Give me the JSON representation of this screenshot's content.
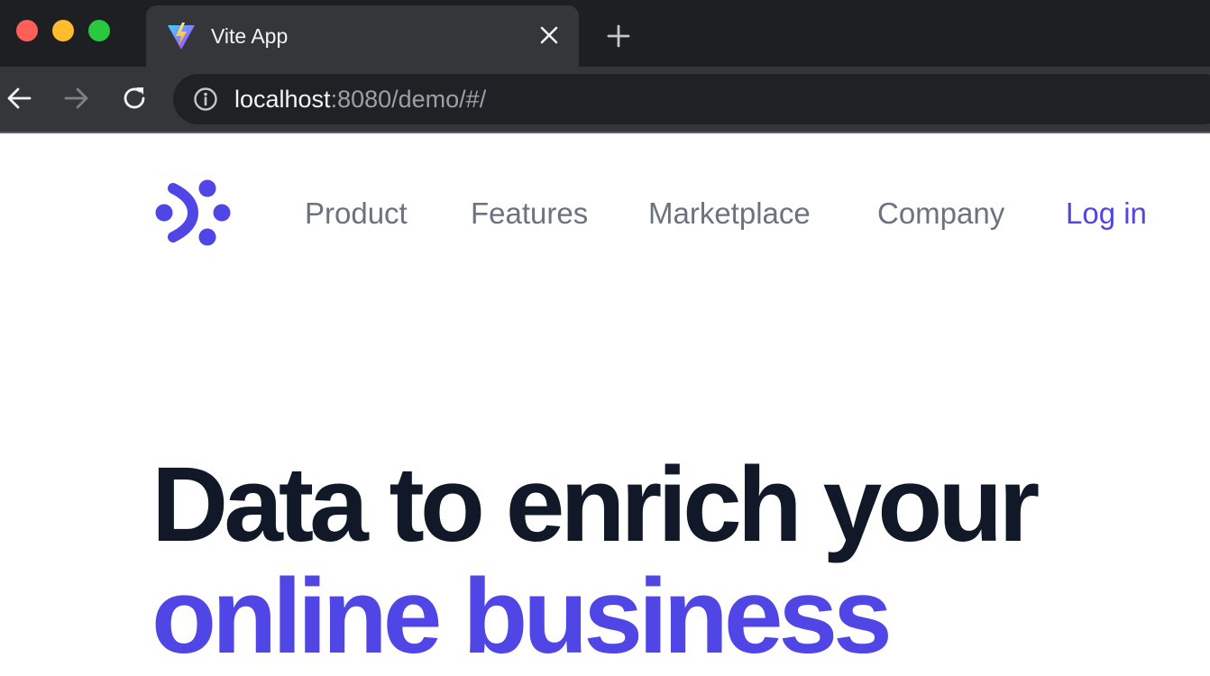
{
  "browser": {
    "tab": {
      "title": "Vite App",
      "favicon": "vite-logo-icon"
    },
    "address": {
      "host": "localhost",
      "rest": ":8080/demo/#/"
    }
  },
  "site": {
    "brand_color": "#4f46e5",
    "nav": {
      "product": "Product",
      "features": "Features",
      "marketplace": "Marketplace",
      "company": "Company",
      "login": "Log in"
    },
    "hero": {
      "line1": "Data to enrich your",
      "line2": "online business"
    }
  }
}
